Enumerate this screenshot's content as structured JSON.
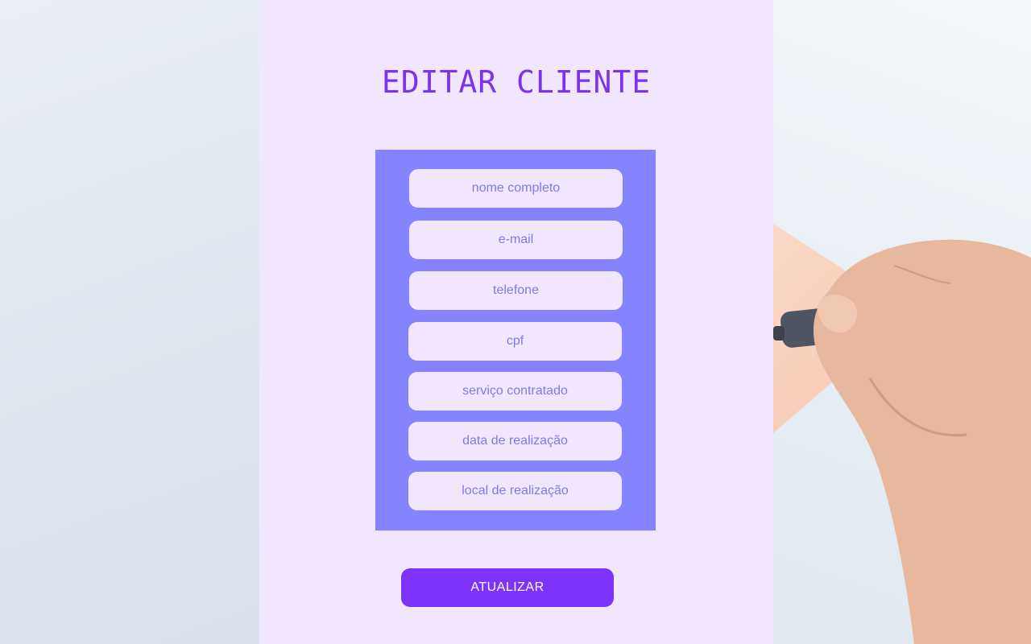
{
  "page": {
    "title": "EDITAR CLIENTE"
  },
  "form": {
    "fields": [
      {
        "name": "nome",
        "placeholder": "nome completo"
      },
      {
        "name": "email",
        "placeholder": "e-mail"
      },
      {
        "name": "telefone",
        "placeholder": "telefone"
      },
      {
        "name": "cpf",
        "placeholder": "cpf"
      },
      {
        "name": "servico",
        "placeholder": "serviço contratado"
      },
      {
        "name": "data",
        "placeholder": "data de realização"
      },
      {
        "name": "local",
        "placeholder": "local de realização"
      }
    ],
    "submit_label": "ATUALIZAR"
  },
  "colors": {
    "accent": "#7d33fb",
    "panel_bg": "#f1e6fe",
    "form_bg": "#8683ff",
    "placeholder": "#7f7ce8"
  }
}
